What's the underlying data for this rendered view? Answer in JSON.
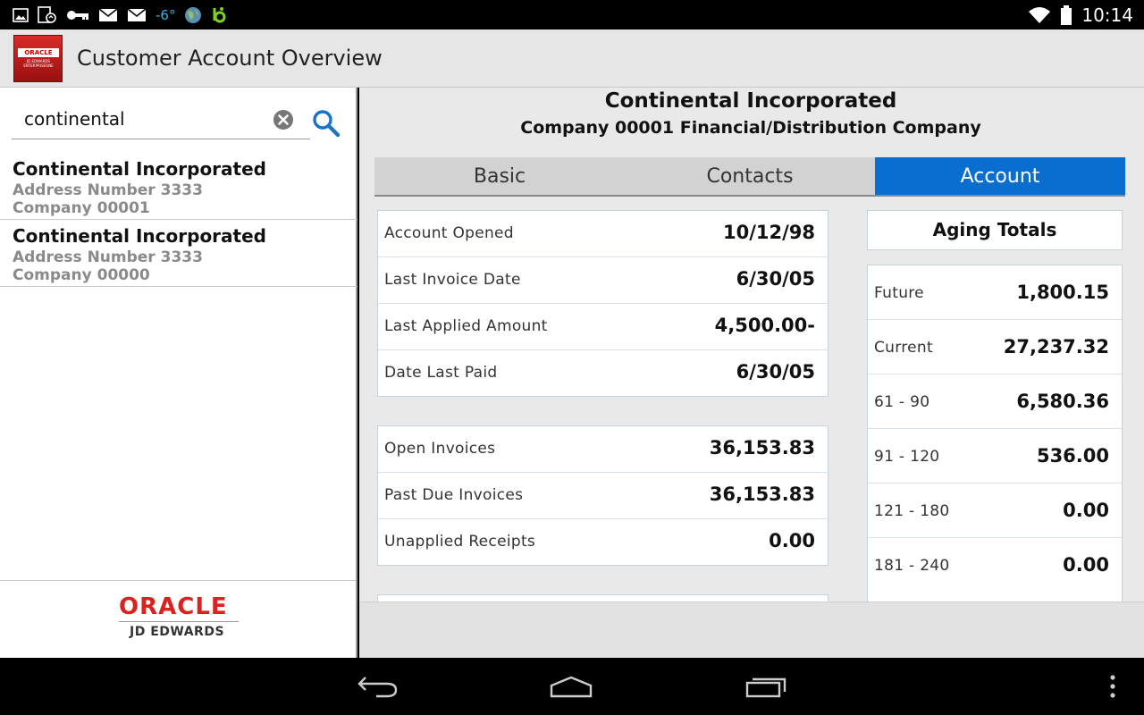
{
  "status_bar": {
    "temperature": "-6°",
    "time": "10:14"
  },
  "app_bar": {
    "title": "Customer Account Overview",
    "logo_text_top": "ORACLE",
    "logo_text_bottom": "JD EDWARDS ENTERPRISEONE"
  },
  "search": {
    "value": "continental"
  },
  "results": [
    {
      "name": "Continental Incorporated",
      "address": "Address Number 3333",
      "company": "Company 00001"
    },
    {
      "name": "Continental Incorporated",
      "address": "Address Number 3333",
      "company": "Company 00000"
    }
  ],
  "footer_logo": {
    "brand": "ORACLE",
    "product": "JD EDWARDS"
  },
  "detail": {
    "title": "Continental Incorporated",
    "subtitle": "Company  00001  Financial/Distribution Company",
    "tabs": [
      {
        "label": "Basic",
        "active": false
      },
      {
        "label": "Contacts",
        "active": false
      },
      {
        "label": "Account",
        "active": true
      }
    ],
    "account_card": [
      {
        "label": "Account Opened",
        "value": "10/12/98"
      },
      {
        "label": "Last Invoice Date",
        "value": "6/30/05"
      },
      {
        "label": "Last Applied Amount",
        "value": "4,500.00-"
      },
      {
        "label": "Date Last Paid",
        "value": "6/30/05"
      }
    ],
    "invoice_card": [
      {
        "label": "Open Invoices",
        "value": "36,153.83"
      },
      {
        "label": "Past Due Invoices",
        "value": "36,153.83"
      },
      {
        "label": "Unapplied Receipts",
        "value": "0.00"
      }
    ],
    "aging_title": "Aging Totals",
    "aging": [
      {
        "label": "Future",
        "value": "1,800.15"
      },
      {
        "label": "Current",
        "value": "27,237.32"
      },
      {
        "label": "61 - 90",
        "value": "6,580.36"
      },
      {
        "label": "91 - 120",
        "value": "536.00"
      },
      {
        "label": "121 - 180",
        "value": "0.00"
      },
      {
        "label": "181 - 240",
        "value": "0.00"
      }
    ]
  },
  "colors": {
    "accent": "#0a6ed1",
    "oracle_red": "#d9231f",
    "status_blue": "#33b5e5",
    "status_green": "#7ed321"
  }
}
